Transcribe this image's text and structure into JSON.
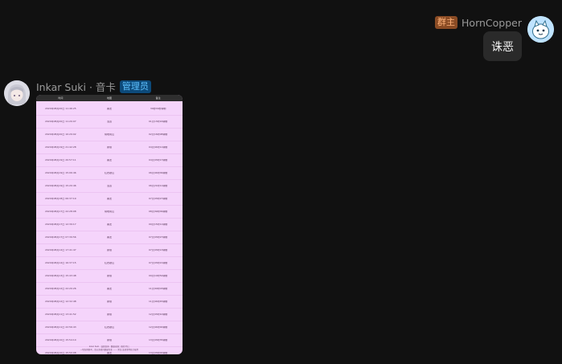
{
  "right_message": {
    "badge": "群主",
    "username": "HornCopper",
    "text": "诛恶",
    "avatar_icon": "ghost-cat-avatar-icon"
  },
  "left_message": {
    "username": "Inkar Suki · 音卡",
    "badge": "管理员",
    "avatar_icon": "anime-girl-avatar-icon"
  },
  "card": {
    "headers": [
      "时间",
      "地图",
      "备注"
    ],
    "rows": [
      [
        "2024年08月20日 11:46:25",
        "黑龙",
        "30秒09秒钟前"
      ],
      [
        "2024年08月20日 11:20:07",
        "洛道",
        "01天13时16钟前"
      ],
      [
        "2024年08月20日 10:29:02",
        "阴地南山",
        "02天16时08钟前"
      ],
      [
        "2024年08月19日 21:42:28",
        "瞿塘",
        "04天04时11钟前"
      ],
      [
        "2024年08月19日 20:57:11",
        "黑龙",
        "04天03时17钟前"
      ],
      [
        "2024年08月19日 15:06:46",
        "红衣歌山",
        "06天04时09钟前"
      ],
      [
        "2024年08月19日 15:20:46",
        "洛道",
        "06天21时11钟前"
      ],
      [
        "2024年08月18日 06:37:19",
        "黑龙",
        "07天03时27钟前"
      ],
      [
        "2024年08月17日 22:28:08",
        "阴地南山",
        "08天09时09钟前"
      ],
      [
        "2024年08月17日 12:39:17",
        "黑龙",
        "09天15时11钟前"
      ],
      [
        "2024年08月17日 07:39:56",
        "黑龙",
        "07天03时27钟前"
      ],
      [
        "2024年08月14日 17:41:47",
        "瞿塘",
        "07天03时13钟前"
      ],
      [
        "2024年08月14日 16:37:15",
        "红衣歌山",
        "07天03时21钟前"
      ],
      [
        "2024年08月13日 15:43:48",
        "瞿塘",
        "09天10时54钟前"
      ],
      [
        "2024年08月12日 22:20:26",
        "黑龙",
        "11天00时03钟前"
      ],
      [
        "2024年08月12日 12:32:48",
        "瞿塘",
        "11天04时45钟前"
      ],
      [
        "2024年08月11日 13:41:52",
        "瞿塘",
        "12天03时10钟前"
      ],
      [
        "2024年08月11日 22:56:43",
        "红衣歌山",
        "12天04时00钟前"
      ],
      [
        "2024年08月10日 15:54:10",
        "瞿塘",
        "13天03时35钟前"
      ],
      [
        "2024年08月10日 15:50:08",
        "黑龙",
        "13天03时00钟前"
      ]
    ],
    "footer_line1": "Inkar Suki · 诛恶查询 · 数据来源：推栏/剑三",
    "footer_line2": "一切仅供参考，请以游戏内数据为准 —— 黑龙·诛恶事件统计插件"
  }
}
